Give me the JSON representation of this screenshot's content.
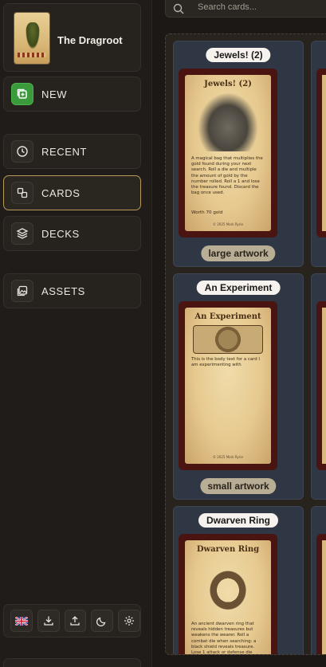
{
  "project": {
    "title": "The Dragroot",
    "thumb_icon": "card-thumbnail"
  },
  "nav": {
    "new_label": "NEW",
    "recent_label": "RECENT",
    "cards_label": "CARDS",
    "decks_label": "DECKS",
    "assets_label": "ASSETS"
  },
  "footer": {
    "buttons": [
      "language-flag-icon",
      "download-icon",
      "upload-icon",
      "moon-icon",
      "gear-icon"
    ]
  },
  "search": {
    "placeholder": "Search cards..."
  },
  "cards": [
    {
      "name": "Jewels! (2)",
      "card_title": "Jewels! (2)",
      "body": "A magical bag that multiplies the gold found during your next search. Roll a die and multiple the amount of gold by the number rolled. Roll a 1 and lose the treasure found. Discard the bag once used.",
      "worth": "Worth 70 gold",
      "copyright": "© 2025 Mark Ryrie",
      "tag": "large artwork"
    },
    {
      "name": "An Experiment",
      "card_title": "An Experiment",
      "body": "This is the body text for a card I am experimenting with",
      "copyright": "© 2025 Mark Ryrie",
      "tag": "small artwork"
    },
    {
      "name": "Dwarven Ring",
      "card_title": "Dwarven Ring",
      "body": "An ancient dwarven ring that reveals hidden treasures but weakens the wearer. Roll a combat die when searching: a black shield reveals treasure. Lose 1 attack or defense die while worn. Must be worn at the"
    }
  ],
  "colors": {
    "accent_border": "#b89a5a",
    "new_button": "#3b9a3b",
    "tile_bg": "#2e3743",
    "card_frame": "#4a1410"
  }
}
